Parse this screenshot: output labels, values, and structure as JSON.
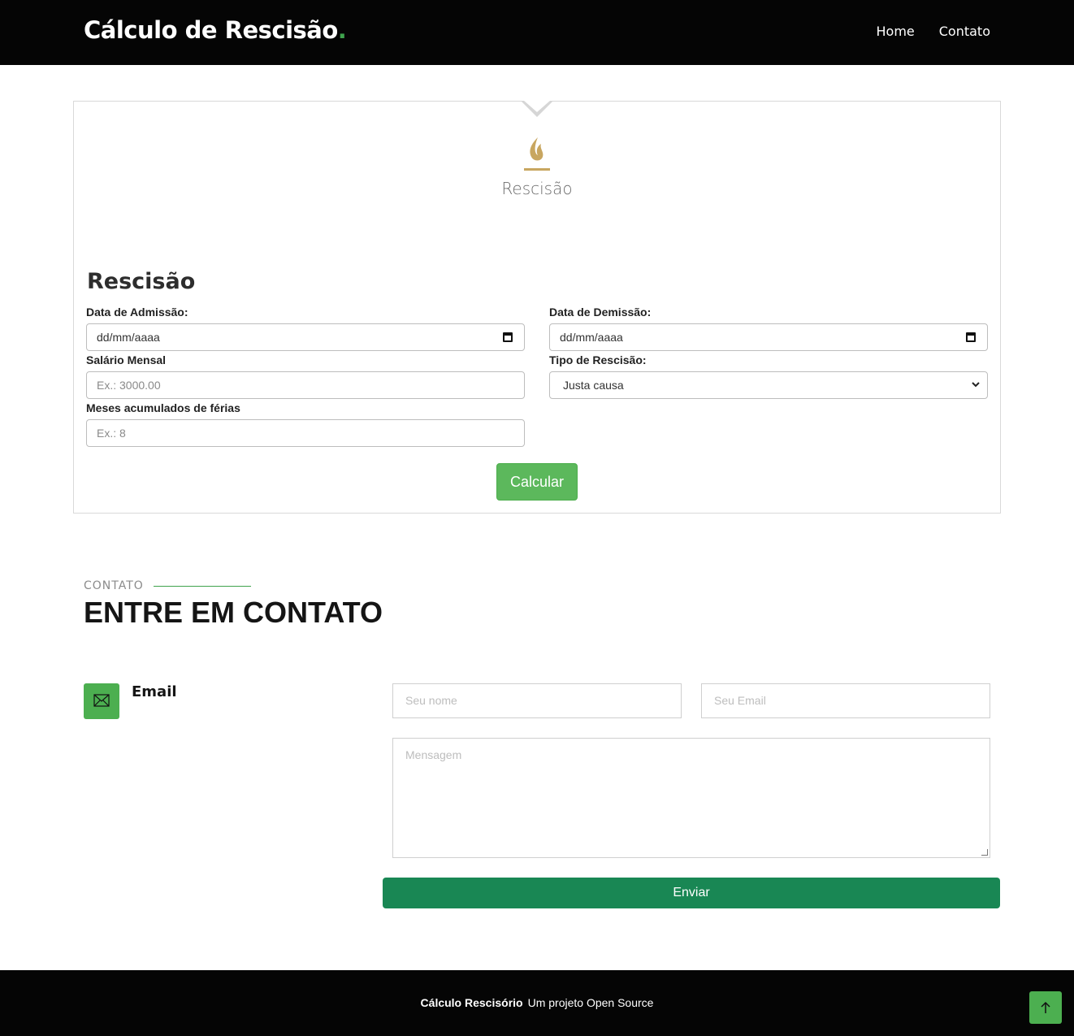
{
  "header": {
    "brand": "Cálculo de Rescisão",
    "brand_dot": ".",
    "nav": [
      "Home",
      "Contato"
    ]
  },
  "tab": {
    "label": "Rescisão",
    "icon": "flame-icon"
  },
  "form": {
    "title": "Rescisão",
    "admissao_label": "Data de Admissão:",
    "admissao_placeholder": "dd/mm/aaaa",
    "demissao_label": "Data de Demissão:",
    "demissao_placeholder": "dd/mm/aaaa",
    "salario_label": "Salário Mensal",
    "salario_placeholder": "Ex.: 3000.00",
    "tipo_label": "Tipo de Rescisão:",
    "tipo_value": "Justa causa",
    "ferias_label": "Meses acumulados de férias",
    "ferias_placeholder": "Ex.: 8",
    "submit_label": "Calcular"
  },
  "contact": {
    "kicker": "CONTATO",
    "title": "ENTRE EM CONTATO",
    "email_label": "Email",
    "name_placeholder": "Seu nome",
    "email_placeholder": "Seu Email",
    "message_placeholder": "Mensagem",
    "send_label": "Enviar"
  },
  "footer": {
    "strong": "Cálculo Rescisório",
    "text": "Um projeto Open Source"
  },
  "colors": {
    "accent": "#3fa34d",
    "button": "#5cb85c",
    "send": "#198754",
    "flame": "#c8a660"
  }
}
